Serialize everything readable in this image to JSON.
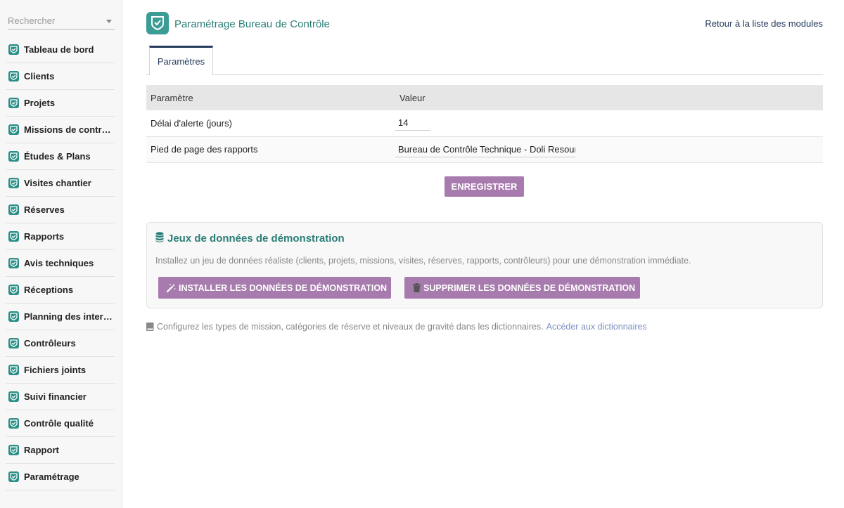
{
  "sidebar": {
    "search_placeholder": "Rechercher",
    "items": [
      {
        "label": "Tableau de bord"
      },
      {
        "label": "Clients"
      },
      {
        "label": "Projets"
      },
      {
        "label": "Missions de contrôle"
      },
      {
        "label": "Études & Plans"
      },
      {
        "label": "Visites chantier"
      },
      {
        "label": "Réserves"
      },
      {
        "label": "Rapports"
      },
      {
        "label": "Avis techniques"
      },
      {
        "label": "Réceptions"
      },
      {
        "label": "Planning des interventions"
      },
      {
        "label": "Contrôleurs"
      },
      {
        "label": "Fichiers joints"
      },
      {
        "label": "Suivi financier"
      },
      {
        "label": "Contrôle qualité"
      },
      {
        "label": "Rapport"
      },
      {
        "label": "Paramétrage"
      }
    ],
    "icon": "shield-check-icon",
    "icon_color": "#2b8f87"
  },
  "header": {
    "title": "Paramétrage Bureau de Contrôle",
    "back_link": "Retour à la liste des modules"
  },
  "tabs": [
    {
      "label": "Paramètres"
    }
  ],
  "table": {
    "headers": [
      "Paramètre",
      "Valeur"
    ],
    "rows": [
      {
        "label": "Délai d'alerte (jours)",
        "value": "14"
      },
      {
        "label": "Pied de page des rapports",
        "value": "Bureau de Contrôle Technique - Doli Resources"
      }
    ]
  },
  "save_button": "ENREGISTRER",
  "demo": {
    "title": "Jeux de données de démonstration",
    "description": "Installez un jeu de données réaliste (clients, projets, missions, visites, réserves, rapports, contrôleurs) pour une démonstration immédiate.",
    "install_button": "INSTALLER LES DONNÉES DE DÉMONSTRATION",
    "delete_button": "SUPPRIMER LES DONNÉES DE DÉMONSTRATION"
  },
  "footer": {
    "note": "Configurez les types de mission, catégories de réserve et niveaux de gravité dans les dictionnaires.",
    "link": "Accéder aux dictionnaires"
  },
  "colors": {
    "accent": "#a77bad",
    "brand": "#2a7d77",
    "link": "#7b8fc0"
  }
}
